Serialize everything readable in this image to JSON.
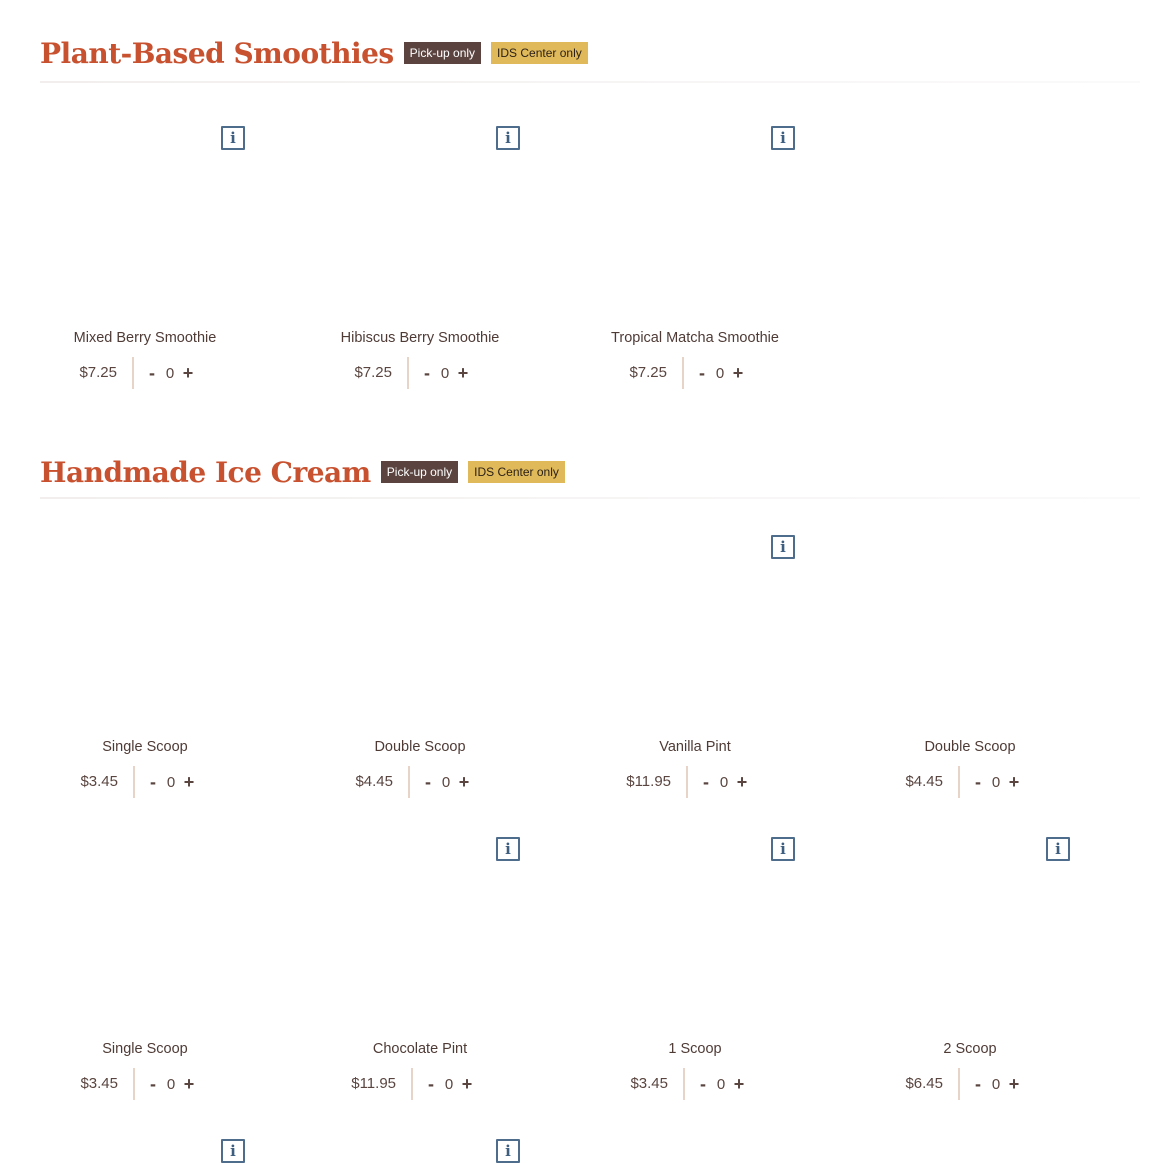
{
  "sections": [
    {
      "title": "Plant-Based Smoothies",
      "badges": [
        "Pick-up only",
        "IDS Center only"
      ],
      "items": [
        {
          "name": "Mixed Berry Smoothie",
          "price": "$7.25",
          "qty": "0",
          "has_info": true
        },
        {
          "name": "Hibiscus Berry Smoothie",
          "price": "$7.25",
          "qty": "0",
          "has_info": true
        },
        {
          "name": "Tropical Matcha Smoothie",
          "price": "$7.25",
          "qty": "0",
          "has_info": true
        }
      ]
    },
    {
      "title": "Handmade Ice Cream",
      "badges": [
        "Pick-up only",
        "IDS Center only"
      ],
      "items": [
        {
          "name": "Single Scoop",
          "price": "$3.45",
          "qty": "0",
          "has_info": false
        },
        {
          "name": "Double Scoop",
          "price": "$4.45",
          "qty": "0",
          "has_info": false
        },
        {
          "name": "Vanilla Pint",
          "price": "$11.95",
          "qty": "0",
          "has_info": true
        },
        {
          "name": "Double Scoop",
          "price": "$4.45",
          "qty": "0",
          "has_info": false
        },
        {
          "name": "Single Scoop",
          "price": "$3.45",
          "qty": "0",
          "has_info": false
        },
        {
          "name": "Chocolate Pint",
          "price": "$11.95",
          "qty": "0",
          "has_info": true
        },
        {
          "name": "1 Scoop",
          "price": "$3.45",
          "qty": "0",
          "has_info": true
        },
        {
          "name": "2 Scoop",
          "price": "$6.45",
          "qty": "0",
          "has_info": true
        }
      ]
    }
  ],
  "controls": {
    "minus": "-",
    "plus": "+",
    "info": "i"
  },
  "icons": {
    "info": "info-icon"
  },
  "colors": {
    "title": "#c8512f",
    "badge_dark": "#5b4440",
    "badge_gold": "#e0ba5a",
    "info_border": "#4e6c8c"
  }
}
